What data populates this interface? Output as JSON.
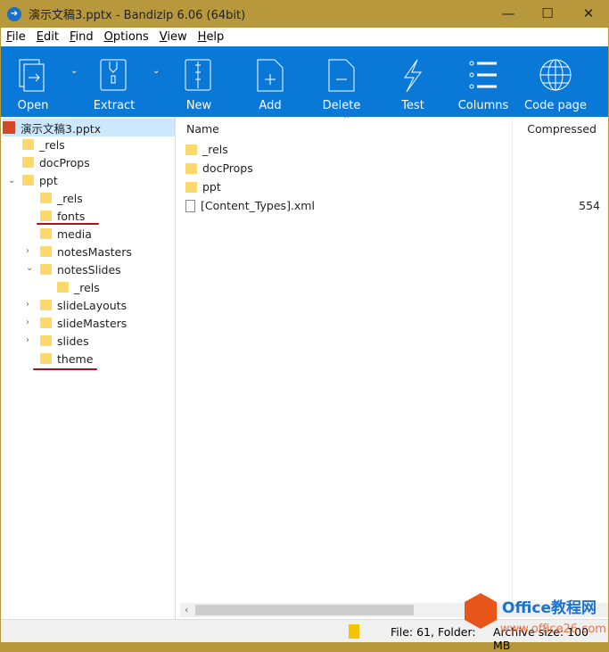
{
  "title": "演示文稿3.pptx - Bandizip 6.06 (64bit)",
  "menu": [
    "File",
    "Edit",
    "Find",
    "Options",
    "View",
    "Help"
  ],
  "toolbar": [
    "Open",
    "Extract",
    "New",
    "Add",
    "Delete",
    "Test",
    "Columns",
    "Code page"
  ],
  "tree": {
    "root": "演示文稿3.pptx",
    "items": [
      "_rels",
      "docProps",
      "ppt",
      "_rels",
      "fonts",
      "media",
      "notesMasters",
      "notesSlides",
      "_rels",
      "slideLayouts",
      "slideMasters",
      "slides",
      "theme"
    ]
  },
  "list": {
    "col_name": "Name",
    "col_compressed": "Compressed",
    "rows": [
      {
        "name": "_rels",
        "size": ""
      },
      {
        "name": "docProps",
        "size": ""
      },
      {
        "name": "ppt",
        "size": ""
      },
      {
        "name": "[Content_Types].xml",
        "size": "554"
      }
    ]
  },
  "status": {
    "text": "File: 61, Folder: ",
    "archive": "Archive size: 100 MB"
  },
  "watermark": {
    "brand": "Office教程网",
    "url": "www.office26.com"
  }
}
